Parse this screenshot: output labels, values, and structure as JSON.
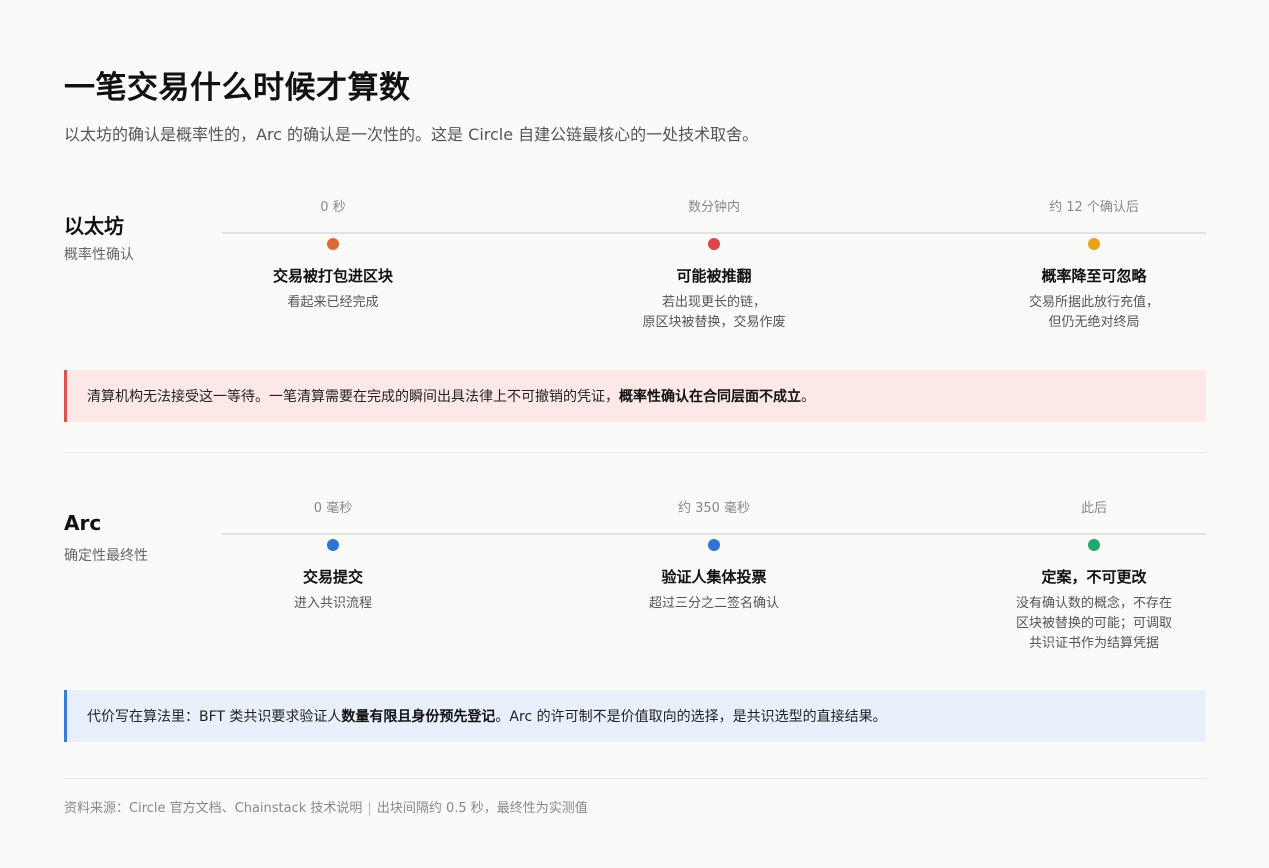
{
  "header": {
    "title": "一笔交易什么时候才算数",
    "subtitle": "以太坊的确认是概率性的，Arc 的确认是一次性的。这是 Circle 自建公链最核心的一处技术取舍。"
  },
  "ethereum": {
    "name": "以太坊",
    "sub": "概率性确认",
    "stages": [
      {
        "time": "0 秒",
        "color": "#e0673a",
        "title": "交易被打包进区块",
        "desc": [
          "看起来已经完成"
        ]
      },
      {
        "time": "数分钟内",
        "color": "#dc4449",
        "title": "可能被推翻",
        "desc": [
          "若出现更长的链，",
          "原区块被替换，交易作废"
        ]
      },
      {
        "time": "约 12 个确认后",
        "color": "#e8a21a",
        "title": "概率降至可忽略",
        "desc": [
          "交易所据此放行充值，",
          "但仍无绝对终局"
        ]
      }
    ],
    "callout": {
      "text": "清算机构无法接受这一等待。一笔清算需要在完成的瞬间出具法律上不可撤销的凭证，",
      "bold": "概率性确认在合同层面不成立",
      "end": "。"
    }
  },
  "arc": {
    "name": "Arc",
    "sub": "确定性最终性",
    "stages": [
      {
        "time": "0 毫秒",
        "color": "#2f74d0",
        "title": "交易提交",
        "desc": [
          "进入共识流程"
        ]
      },
      {
        "time": "约 350 毫秒",
        "color": "#2f74d0",
        "title": "验证人集体投票",
        "desc": [
          "超过三分之二签名确认"
        ]
      },
      {
        "time": "此后",
        "color": "#22a86a",
        "title": "定案，不可更改",
        "desc": [
          "没有确认数的概念，不存在",
          "区块被替换的可能；可调取",
          "共识证书作为结算凭据"
        ]
      }
    ],
    "callout": {
      "text": "代价写在算法里：BFT 类共识要求验证人",
      "bold": "数量有限且身份预先登记",
      "end": "。Arc 的许可制不是价值取向的选择，是共识选型的直接结果。"
    }
  },
  "footer": {
    "source": "资料来源：Circle 官方文档、Chainstack 技术说明",
    "separator": "|",
    "note": "出块间隔约 0.5 秒，最终性为实测值"
  }
}
